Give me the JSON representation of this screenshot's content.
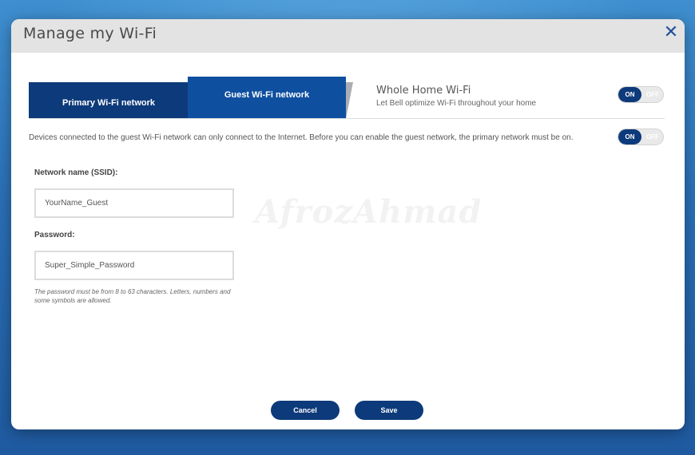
{
  "modal": {
    "title": "Manage my Wi-Fi",
    "close_icon": "close-icon"
  },
  "tabs": [
    {
      "label": "Primary Wi-Fi network",
      "active": false
    },
    {
      "label": "Guest Wi-Fi network",
      "active": true
    }
  ],
  "whole_home": {
    "title": "Whole Home Wi-Fi",
    "subtitle": "Let Bell optimize Wi-Fi throughout your home",
    "toggle": {
      "on_label": "ON",
      "off_label": "OFF",
      "state": "on"
    }
  },
  "guest": {
    "notice": "Devices connected to the guest Wi-Fi network can only connect to the Internet. Before you can enable the guest network, the primary network must be on.",
    "toggle": {
      "on_label": "ON",
      "off_label": "OFF",
      "state": "on"
    },
    "ssid_label": "Network name (SSID):",
    "ssid_value": "YourName_Guest",
    "password_label": "Password:",
    "password_value": "Super_Simple_Password",
    "password_hint": "The password must be from 8 to 63 characters. Letters, numbers and some symbols are allowed."
  },
  "watermark": "AfrozAhmad",
  "buttons": {
    "cancel": "Cancel",
    "save": "Save"
  },
  "colors": {
    "primary_dark": "#0d3a7a",
    "primary": "#0f4fa0",
    "close": "#1f4f9c"
  }
}
